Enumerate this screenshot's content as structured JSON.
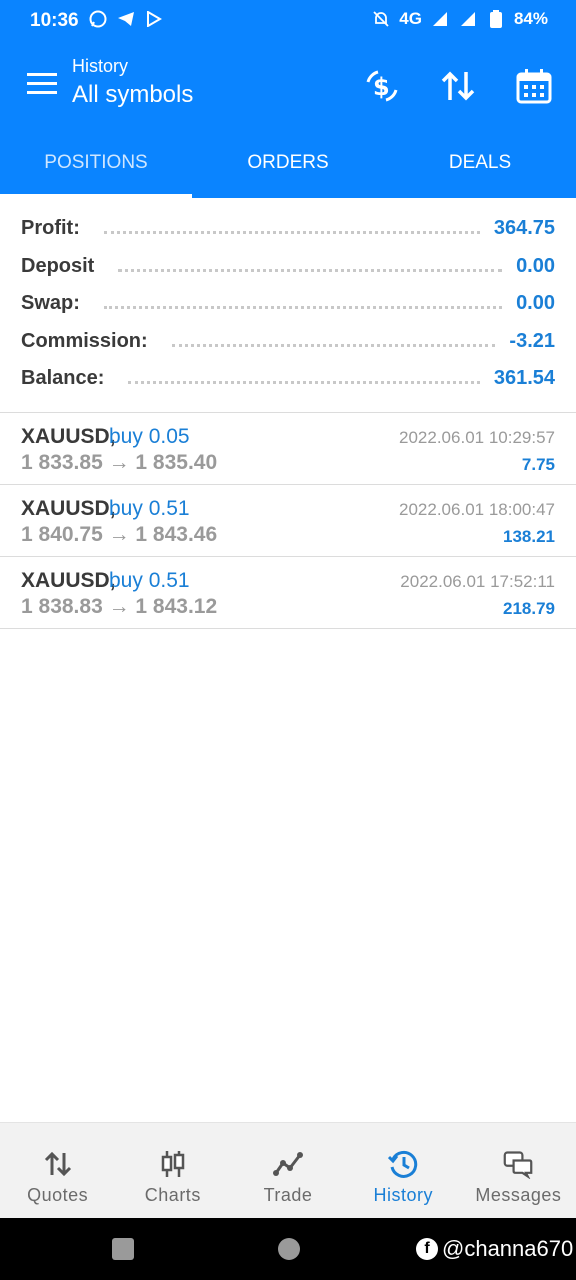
{
  "status_bar": {
    "time": "10:36",
    "left_icons": [
      "whatsapp-icon",
      "telegram-icon",
      "play-store-icon"
    ],
    "network": "4G",
    "battery": "84%"
  },
  "app_bar": {
    "title_small": "History",
    "title_large": "All symbols",
    "actions": [
      "currency-filter-icon",
      "sort-icon",
      "calendar-icon"
    ]
  },
  "tabs": [
    {
      "label": "POSITIONS",
      "active": true
    },
    {
      "label": "ORDERS",
      "active": false
    },
    {
      "label": "DEALS",
      "active": false
    }
  ],
  "summary": [
    {
      "label": "Profit:",
      "value": "364.75"
    },
    {
      "label": "Deposit",
      "value": "0.00"
    },
    {
      "label": "Swap:",
      "value": "0.00"
    },
    {
      "label": "Commission:",
      "value": "-3.21"
    },
    {
      "label": "Balance:",
      "value": "361.54"
    }
  ],
  "deals": [
    {
      "symbol": "XAUUSD,",
      "type": "buy 0.05",
      "prices": "1 833.85 → 1 835.40",
      "time": "2022.06.01 10:29:57",
      "profit": "7.75"
    },
    {
      "symbol": "XAUUSD,",
      "type": "buy 0.51",
      "prices": "1 840.75 → 1 843.46",
      "time": "2022.06.01 18:00:47",
      "profit": "138.21"
    },
    {
      "symbol": "XAUUSD,",
      "type": "buy 0.51",
      "prices": "1 838.83 → 1 843.12",
      "time": "2022.06.01 17:52:11",
      "profit": "218.79"
    }
  ],
  "bottom_nav": [
    {
      "label": "Quotes",
      "icon": "quotes-arrows-icon",
      "active": false
    },
    {
      "label": "Charts",
      "icon": "candlestick-icon",
      "active": false
    },
    {
      "label": "Trade",
      "icon": "trade-line-icon",
      "active": false
    },
    {
      "label": "History",
      "icon": "history-clock-icon",
      "active": true
    },
    {
      "label": "Messages",
      "icon": "messages-icon",
      "active": false
    }
  ],
  "watermark": "@channa670",
  "colors": {
    "primary": "#0a84ff",
    "accent_text": "#1a7fd6",
    "label_text": "#3a3a3a",
    "muted_text": "#9a9a9a"
  }
}
